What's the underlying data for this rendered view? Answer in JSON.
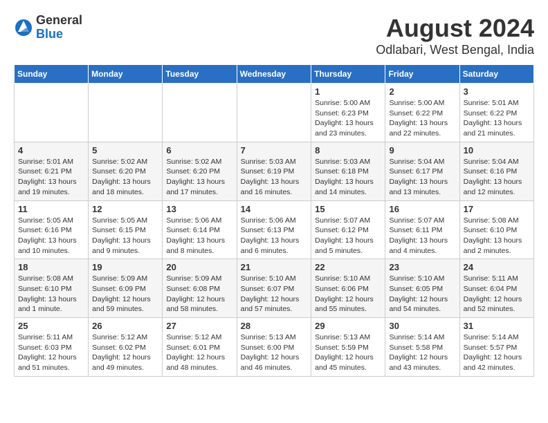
{
  "header": {
    "logo_general": "General",
    "logo_blue": "Blue",
    "title": "August 2024",
    "subtitle": "Odlabari, West Bengal, India"
  },
  "days_of_week": [
    "Sunday",
    "Monday",
    "Tuesday",
    "Wednesday",
    "Thursday",
    "Friday",
    "Saturday"
  ],
  "weeks": [
    [
      {
        "day": "",
        "info": ""
      },
      {
        "day": "",
        "info": ""
      },
      {
        "day": "",
        "info": ""
      },
      {
        "day": "",
        "info": ""
      },
      {
        "day": "1",
        "info": "Sunrise: 5:00 AM\nSunset: 6:23 PM\nDaylight: 13 hours\nand 23 minutes."
      },
      {
        "day": "2",
        "info": "Sunrise: 5:00 AM\nSunset: 6:22 PM\nDaylight: 13 hours\nand 22 minutes."
      },
      {
        "day": "3",
        "info": "Sunrise: 5:01 AM\nSunset: 6:22 PM\nDaylight: 13 hours\nand 21 minutes."
      }
    ],
    [
      {
        "day": "4",
        "info": "Sunrise: 5:01 AM\nSunset: 6:21 PM\nDaylight: 13 hours\nand 19 minutes."
      },
      {
        "day": "5",
        "info": "Sunrise: 5:02 AM\nSunset: 6:20 PM\nDaylight: 13 hours\nand 18 minutes."
      },
      {
        "day": "6",
        "info": "Sunrise: 5:02 AM\nSunset: 6:20 PM\nDaylight: 13 hours\nand 17 minutes."
      },
      {
        "day": "7",
        "info": "Sunrise: 5:03 AM\nSunset: 6:19 PM\nDaylight: 13 hours\nand 16 minutes."
      },
      {
        "day": "8",
        "info": "Sunrise: 5:03 AM\nSunset: 6:18 PM\nDaylight: 13 hours\nand 14 minutes."
      },
      {
        "day": "9",
        "info": "Sunrise: 5:04 AM\nSunset: 6:17 PM\nDaylight: 13 hours\nand 13 minutes."
      },
      {
        "day": "10",
        "info": "Sunrise: 5:04 AM\nSunset: 6:16 PM\nDaylight: 13 hours\nand 12 minutes."
      }
    ],
    [
      {
        "day": "11",
        "info": "Sunrise: 5:05 AM\nSunset: 6:16 PM\nDaylight: 13 hours\nand 10 minutes."
      },
      {
        "day": "12",
        "info": "Sunrise: 5:05 AM\nSunset: 6:15 PM\nDaylight: 13 hours\nand 9 minutes."
      },
      {
        "day": "13",
        "info": "Sunrise: 5:06 AM\nSunset: 6:14 PM\nDaylight: 13 hours\nand 8 minutes."
      },
      {
        "day": "14",
        "info": "Sunrise: 5:06 AM\nSunset: 6:13 PM\nDaylight: 13 hours\nand 6 minutes."
      },
      {
        "day": "15",
        "info": "Sunrise: 5:07 AM\nSunset: 6:12 PM\nDaylight: 13 hours\nand 5 minutes."
      },
      {
        "day": "16",
        "info": "Sunrise: 5:07 AM\nSunset: 6:11 PM\nDaylight: 13 hours\nand 4 minutes."
      },
      {
        "day": "17",
        "info": "Sunrise: 5:08 AM\nSunset: 6:10 PM\nDaylight: 13 hours\nand 2 minutes."
      }
    ],
    [
      {
        "day": "18",
        "info": "Sunrise: 5:08 AM\nSunset: 6:10 PM\nDaylight: 13 hours\nand 1 minute."
      },
      {
        "day": "19",
        "info": "Sunrise: 5:09 AM\nSunset: 6:09 PM\nDaylight: 12 hours\nand 59 minutes."
      },
      {
        "day": "20",
        "info": "Sunrise: 5:09 AM\nSunset: 6:08 PM\nDaylight: 12 hours\nand 58 minutes."
      },
      {
        "day": "21",
        "info": "Sunrise: 5:10 AM\nSunset: 6:07 PM\nDaylight: 12 hours\nand 57 minutes."
      },
      {
        "day": "22",
        "info": "Sunrise: 5:10 AM\nSunset: 6:06 PM\nDaylight: 12 hours\nand 55 minutes."
      },
      {
        "day": "23",
        "info": "Sunrise: 5:10 AM\nSunset: 6:05 PM\nDaylight: 12 hours\nand 54 minutes."
      },
      {
        "day": "24",
        "info": "Sunrise: 5:11 AM\nSunset: 6:04 PM\nDaylight: 12 hours\nand 52 minutes."
      }
    ],
    [
      {
        "day": "25",
        "info": "Sunrise: 5:11 AM\nSunset: 6:03 PM\nDaylight: 12 hours\nand 51 minutes."
      },
      {
        "day": "26",
        "info": "Sunrise: 5:12 AM\nSunset: 6:02 PM\nDaylight: 12 hours\nand 49 minutes."
      },
      {
        "day": "27",
        "info": "Sunrise: 5:12 AM\nSunset: 6:01 PM\nDaylight: 12 hours\nand 48 minutes."
      },
      {
        "day": "28",
        "info": "Sunrise: 5:13 AM\nSunset: 6:00 PM\nDaylight: 12 hours\nand 46 minutes."
      },
      {
        "day": "29",
        "info": "Sunrise: 5:13 AM\nSunset: 5:59 PM\nDaylight: 12 hours\nand 45 minutes."
      },
      {
        "day": "30",
        "info": "Sunrise: 5:14 AM\nSunset: 5:58 PM\nDaylight: 12 hours\nand 43 minutes."
      },
      {
        "day": "31",
        "info": "Sunrise: 5:14 AM\nSunset: 5:57 PM\nDaylight: 12 hours\nand 42 minutes."
      }
    ]
  ]
}
